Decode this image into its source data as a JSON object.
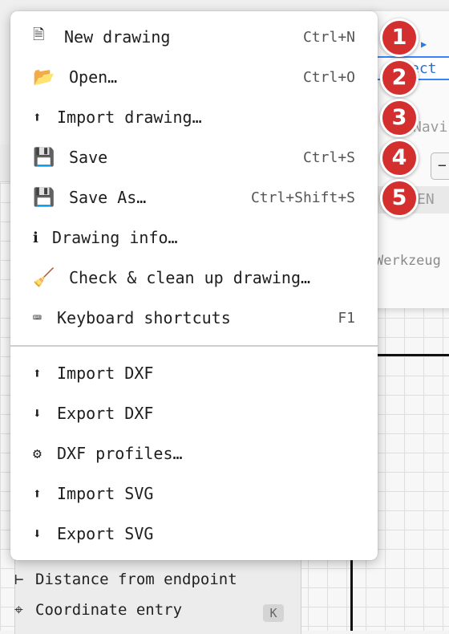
{
  "background": {
    "panel_tab": "ect",
    "panel_nav": "Navi",
    "panel_minus": "−",
    "panel_lang": "EN",
    "panel_tool": "Werkzeug",
    "snap_items": [
      {
        "icon": "⊢",
        "label": "Distance from endpoint"
      },
      {
        "icon": "⌖",
        "label": "Coordinate entry",
        "key": "K"
      }
    ]
  },
  "menu": {
    "items": [
      {
        "icon": "🗎",
        "label": "New drawing",
        "shortcut": "Ctrl+N"
      },
      {
        "icon": "📂",
        "label": "Open…",
        "shortcut": "Ctrl+O"
      },
      {
        "icon": "⬆",
        "label": "Import drawing…",
        "shortcut": ""
      },
      {
        "icon": "💾",
        "label": "Save",
        "shortcut": "Ctrl+S"
      },
      {
        "icon": "💾",
        "label": "Save As…",
        "shortcut": "Ctrl+Shift+S"
      },
      {
        "icon": "ℹ",
        "label": "Drawing info…",
        "shortcut": ""
      },
      {
        "icon": "🧹",
        "label": "Check & clean up drawing…",
        "shortcut": ""
      },
      {
        "icon": "⌨",
        "label": "Keyboard shortcuts",
        "shortcut": "F1"
      },
      {
        "icon": "⬆",
        "label": "Import DXF",
        "shortcut": ""
      },
      {
        "icon": "⬇",
        "label": "Export DXF",
        "shortcut": ""
      },
      {
        "icon": "⚙",
        "label": "DXF profiles…",
        "shortcut": ""
      },
      {
        "icon": "⬆",
        "label": "Import SVG",
        "shortcut": ""
      },
      {
        "icon": "⬇",
        "label": "Export SVG",
        "shortcut": ""
      }
    ]
  },
  "badges": [
    "1",
    "2",
    "3",
    "4",
    "5"
  ],
  "colors": {
    "badge": "#d32f2f",
    "accent": "#3b82f6"
  }
}
